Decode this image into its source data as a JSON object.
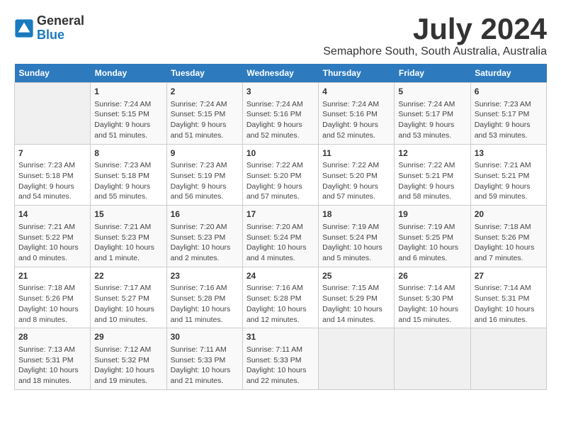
{
  "logo": {
    "name_part1": "General",
    "name_part2": "Blue"
  },
  "header": {
    "month_year": "July 2024",
    "location": "Semaphore South, South Australia, Australia"
  },
  "weekdays": [
    "Sunday",
    "Monday",
    "Tuesday",
    "Wednesday",
    "Thursday",
    "Friday",
    "Saturday"
  ],
  "weeks": [
    [
      {
        "day": "",
        "info": ""
      },
      {
        "day": "1",
        "info": "Sunrise: 7:24 AM\nSunset: 5:15 PM\nDaylight: 9 hours\nand 51 minutes."
      },
      {
        "day": "2",
        "info": "Sunrise: 7:24 AM\nSunset: 5:15 PM\nDaylight: 9 hours\nand 51 minutes."
      },
      {
        "day": "3",
        "info": "Sunrise: 7:24 AM\nSunset: 5:16 PM\nDaylight: 9 hours\nand 52 minutes."
      },
      {
        "day": "4",
        "info": "Sunrise: 7:24 AM\nSunset: 5:16 PM\nDaylight: 9 hours\nand 52 minutes."
      },
      {
        "day": "5",
        "info": "Sunrise: 7:24 AM\nSunset: 5:17 PM\nDaylight: 9 hours\nand 53 minutes."
      },
      {
        "day": "6",
        "info": "Sunrise: 7:23 AM\nSunset: 5:17 PM\nDaylight: 9 hours\nand 53 minutes."
      }
    ],
    [
      {
        "day": "7",
        "info": "Sunrise: 7:23 AM\nSunset: 5:18 PM\nDaylight: 9 hours\nand 54 minutes."
      },
      {
        "day": "8",
        "info": "Sunrise: 7:23 AM\nSunset: 5:18 PM\nDaylight: 9 hours\nand 55 minutes."
      },
      {
        "day": "9",
        "info": "Sunrise: 7:23 AM\nSunset: 5:19 PM\nDaylight: 9 hours\nand 56 minutes."
      },
      {
        "day": "10",
        "info": "Sunrise: 7:22 AM\nSunset: 5:20 PM\nDaylight: 9 hours\nand 57 minutes."
      },
      {
        "day": "11",
        "info": "Sunrise: 7:22 AM\nSunset: 5:20 PM\nDaylight: 9 hours\nand 57 minutes."
      },
      {
        "day": "12",
        "info": "Sunrise: 7:22 AM\nSunset: 5:21 PM\nDaylight: 9 hours\nand 58 minutes."
      },
      {
        "day": "13",
        "info": "Sunrise: 7:21 AM\nSunset: 5:21 PM\nDaylight: 9 hours\nand 59 minutes."
      }
    ],
    [
      {
        "day": "14",
        "info": "Sunrise: 7:21 AM\nSunset: 5:22 PM\nDaylight: 10 hours\nand 0 minutes."
      },
      {
        "day": "15",
        "info": "Sunrise: 7:21 AM\nSunset: 5:23 PM\nDaylight: 10 hours\nand 1 minute."
      },
      {
        "day": "16",
        "info": "Sunrise: 7:20 AM\nSunset: 5:23 PM\nDaylight: 10 hours\nand 2 minutes."
      },
      {
        "day": "17",
        "info": "Sunrise: 7:20 AM\nSunset: 5:24 PM\nDaylight: 10 hours\nand 4 minutes."
      },
      {
        "day": "18",
        "info": "Sunrise: 7:19 AM\nSunset: 5:24 PM\nDaylight: 10 hours\nand 5 minutes."
      },
      {
        "day": "19",
        "info": "Sunrise: 7:19 AM\nSunset: 5:25 PM\nDaylight: 10 hours\nand 6 minutes."
      },
      {
        "day": "20",
        "info": "Sunrise: 7:18 AM\nSunset: 5:26 PM\nDaylight: 10 hours\nand 7 minutes."
      }
    ],
    [
      {
        "day": "21",
        "info": "Sunrise: 7:18 AM\nSunset: 5:26 PM\nDaylight: 10 hours\nand 8 minutes."
      },
      {
        "day": "22",
        "info": "Sunrise: 7:17 AM\nSunset: 5:27 PM\nDaylight: 10 hours\nand 10 minutes."
      },
      {
        "day": "23",
        "info": "Sunrise: 7:16 AM\nSunset: 5:28 PM\nDaylight: 10 hours\nand 11 minutes."
      },
      {
        "day": "24",
        "info": "Sunrise: 7:16 AM\nSunset: 5:28 PM\nDaylight: 10 hours\nand 12 minutes."
      },
      {
        "day": "25",
        "info": "Sunrise: 7:15 AM\nSunset: 5:29 PM\nDaylight: 10 hours\nand 14 minutes."
      },
      {
        "day": "26",
        "info": "Sunrise: 7:14 AM\nSunset: 5:30 PM\nDaylight: 10 hours\nand 15 minutes."
      },
      {
        "day": "27",
        "info": "Sunrise: 7:14 AM\nSunset: 5:31 PM\nDaylight: 10 hours\nand 16 minutes."
      }
    ],
    [
      {
        "day": "28",
        "info": "Sunrise: 7:13 AM\nSunset: 5:31 PM\nDaylight: 10 hours\nand 18 minutes."
      },
      {
        "day": "29",
        "info": "Sunrise: 7:12 AM\nSunset: 5:32 PM\nDaylight: 10 hours\nand 19 minutes."
      },
      {
        "day": "30",
        "info": "Sunrise: 7:11 AM\nSunset: 5:33 PM\nDaylight: 10 hours\nand 21 minutes."
      },
      {
        "day": "31",
        "info": "Sunrise: 7:11 AM\nSunset: 5:33 PM\nDaylight: 10 hours\nand 22 minutes."
      },
      {
        "day": "",
        "info": ""
      },
      {
        "day": "",
        "info": ""
      },
      {
        "day": "",
        "info": ""
      }
    ]
  ]
}
